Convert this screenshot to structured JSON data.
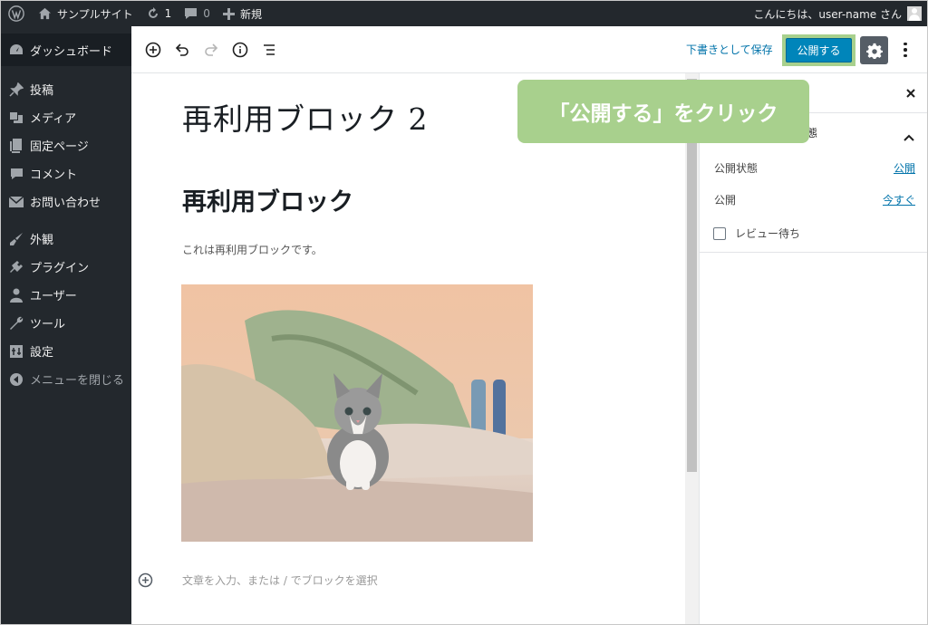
{
  "admin_bar": {
    "site_name": "サンプルサイト",
    "updates_count": "1",
    "comments_count": "0",
    "new_label": "新規",
    "greeting": "こんにちは、user-name さん"
  },
  "sidebar": {
    "items": [
      {
        "label": "ダッシュボード",
        "icon": "dashboard-icon"
      },
      {
        "label": "投稿",
        "icon": "pin-icon"
      },
      {
        "label": "メディア",
        "icon": "media-icon"
      },
      {
        "label": "固定ページ",
        "icon": "page-icon"
      },
      {
        "label": "コメント",
        "icon": "comment-icon"
      },
      {
        "label": "お問い合わせ",
        "icon": "mail-icon"
      },
      {
        "label": "外観",
        "icon": "brush-icon"
      },
      {
        "label": "プラグイン",
        "icon": "plugin-icon"
      },
      {
        "label": "ユーザー",
        "icon": "user-icon"
      },
      {
        "label": "ツール",
        "icon": "wrench-icon"
      },
      {
        "label": "設定",
        "icon": "settings-icon"
      },
      {
        "label": "メニューを閉じる",
        "icon": "collapse-icon"
      }
    ]
  },
  "toolbar": {
    "save_draft_label": "下書きとして保存",
    "publish_label": "公開する"
  },
  "editor": {
    "title": "再利用ブロック 2",
    "heading": "再利用ブロック",
    "paragraph": "これは再利用ブロックです。",
    "placeholder": "文章を入力、または / でブロックを選択"
  },
  "panel": {
    "section_title": "態",
    "status_label": "公開状態",
    "status_value": "公開",
    "publish_label": "公開",
    "publish_value": "今すぐ",
    "review_label": "レビュー待ち"
  },
  "callout": {
    "text": "「公開する」をクリック"
  },
  "colors": {
    "admin_dark": "#23282d",
    "publish_blue": "#0085ba",
    "link_blue": "#0073aa",
    "callout_green": "#a8d08d"
  }
}
